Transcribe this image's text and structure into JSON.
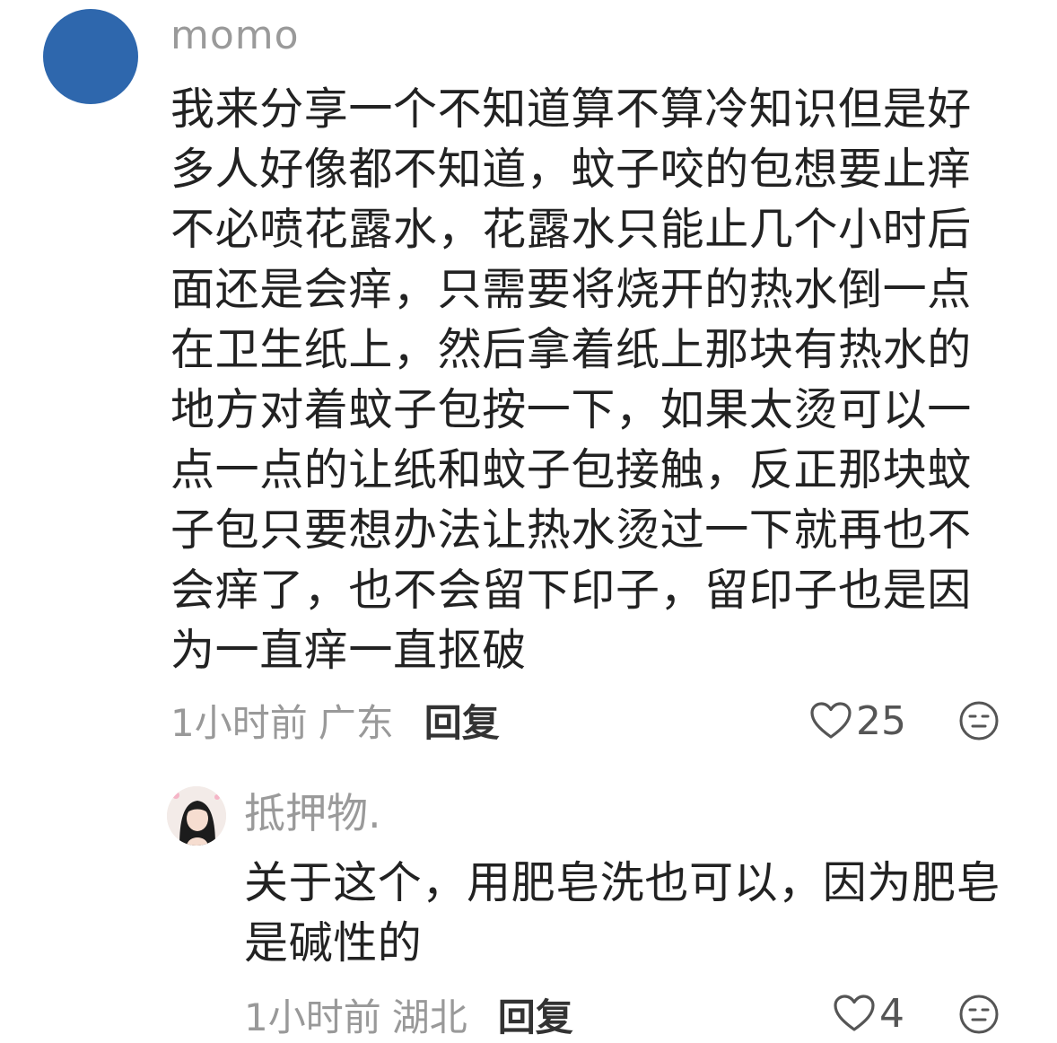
{
  "comment": {
    "username": "momo",
    "text": "我来分享一个不知道算不算冷知识但是好多人好像都不知道，蚊子咬的包想要止痒不必喷花露水，花露水只能止几个小时后面还是会痒，只需要将烧开的热水倒一点在卫生纸上，然后拿着纸上那块有热水的地方对着蚊子包按一下，如果太烫可以一点一点的让纸和蚊子包接触，反正那块蚊子包只要想办法让热水烫过一下就再也不会痒了，也不会留下印子，留印子也是因为一直痒一直抠破",
    "time": "1小时前",
    "region": "广东",
    "reply_label": "回复",
    "likes": "25",
    "avatar_color": "#2e67ad"
  },
  "reply": {
    "username": "抵押物.",
    "text": "关于这个，用肥皂洗也可以，因为肥皂是碱性的",
    "time": "1小时前",
    "region": "湖北",
    "reply_label": "回复",
    "likes": "4"
  },
  "icons": {
    "like": "heart-outline-icon",
    "reaction": "neutral-face-icon"
  }
}
